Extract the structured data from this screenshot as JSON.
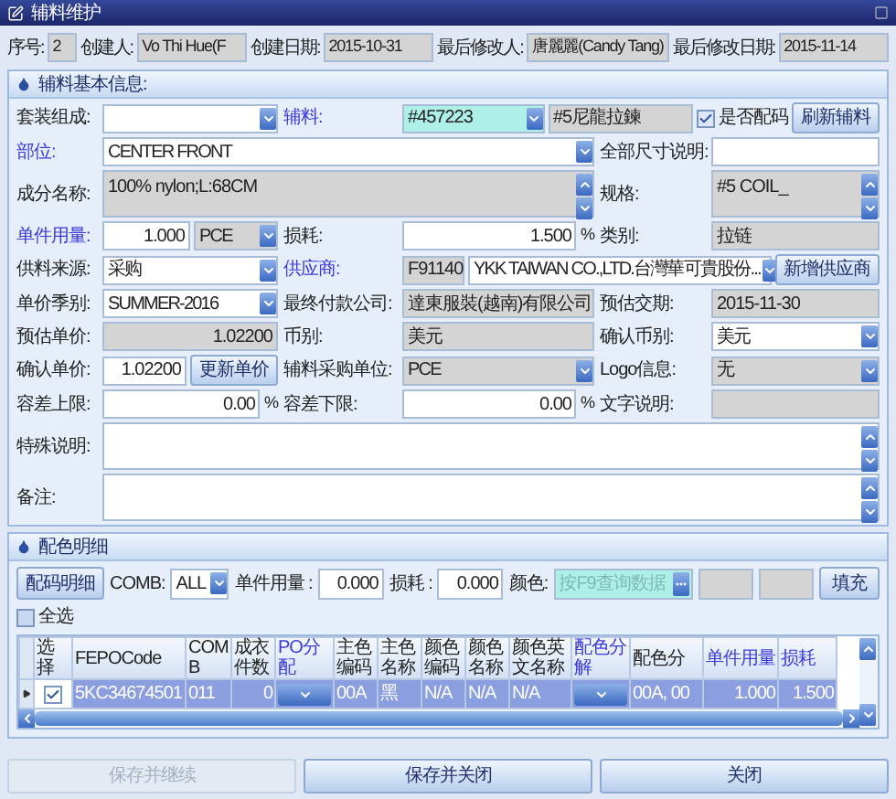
{
  "window": {
    "title": "辅料维护"
  },
  "header": [
    {
      "label": "序号:",
      "value": "2"
    },
    {
      "label": "创建人:",
      "value": "Vo Thi Hue(F"
    },
    {
      "label": "创建日期:",
      "value": "2015-10-31"
    },
    {
      "label": "最后修改人:",
      "value": "唐麗麗(Candy Tang)"
    },
    {
      "label": "最后修改日期:",
      "value": "2015-11-14"
    }
  ],
  "basic_info": {
    "title": "辅料基本信息:",
    "rows": [
      [
        {
          "label": "套装组成:",
          "required": false,
          "controls": [
            {
              "kind": "select",
              "readonly": false
            }
          ]
        },
        {
          "label": "辅料:",
          "required": true,
          "controls": [
            {
              "kind": "lookup",
              "value": "#457223",
              "readonly": false
            },
            {
              "kind": "text",
              "value": "#5尼龍拉鍊",
              "readonly": true
            },
            {
              "kind": "check",
              "label": "是否配码",
              "checked": true
            },
            {
              "kind": "button",
              "label": "刷新辅料"
            }
          ]
        }
      ],
      [
        {
          "label": "部位:",
          "required": true,
          "controls": [
            {
              "kind": "select",
              "value": "CENTER FRONT",
              "readonly": false
            }
          ]
        },
        {
          "label": "全部尺寸说明:",
          "required": false,
          "controls": [
            {
              "kind": "text",
              "readonly": false
            }
          ]
        }
      ],
      [
        {
          "label": "成分名称:",
          "required": false,
          "controls": [
            {
              "kind": "memo",
              "value": "100% nylon;L:68CM",
              "readonly": true
            }
          ]
        },
        {
          "label": "规格:",
          "required": false,
          "controls": [
            {
              "kind": "spin",
              "value": "#5 COIL_",
              "readonly": true
            }
          ]
        }
      ],
      [
        {
          "label": "单件用量:",
          "required": true,
          "controls": [
            {
              "kind": "number",
              "value": "1.000",
              "readonly": false
            },
            {
              "kind": "select",
              "value": "PCE",
              "readonly": true
            }
          ]
        },
        {
          "label": "损耗:",
          "required": false,
          "controls": [
            {
              "kind": "number",
              "value": "1.500",
              "readonly": false
            },
            {
              "kind": "unit",
              "label": "%"
            }
          ]
        },
        {
          "label": "类别:",
          "required": false,
          "controls": [
            {
              "kind": "text",
              "value": "拉链",
              "readonly": true
            }
          ]
        }
      ],
      [
        {
          "label": "供料来源:",
          "required": false,
          "controls": [
            {
              "kind": "select",
              "value": "采购",
              "readonly": false
            }
          ]
        },
        {
          "label": "供应商:",
          "required": true,
          "controls": [
            {
              "kind": "text",
              "value": "F91140",
              "readonly": true
            },
            {
              "kind": "select",
              "value": "YKK TAIWAN CO.,LTD.台灣華可貴股份...",
              "readonly": false
            },
            {
              "kind": "button",
              "label": "新增供应商"
            }
          ]
        }
      ],
      [
        {
          "label": "单价季别:",
          "required": false,
          "controls": [
            {
              "kind": "select",
              "value": "SUMMER-2016",
              "readonly": false
            }
          ]
        },
        {
          "label": "最终付款公司:",
          "required": false,
          "controls": [
            {
              "kind": "text",
              "value": "達東服裝(越南)有限公司",
              "readonly": true
            }
          ]
        },
        {
          "label": "预估交期:",
          "required": false,
          "controls": [
            {
              "kind": "text",
              "value": "2015-11-30",
              "readonly": true
            }
          ]
        }
      ],
      [
        {
          "label": "预估单价:",
          "required": false,
          "controls": [
            {
              "kind": "number",
              "value": "1.02200",
              "readonly": true
            }
          ]
        },
        {
          "label": "币别:",
          "required": false,
          "controls": [
            {
              "kind": "text",
              "value": "美元",
              "readonly": true
            }
          ]
        },
        {
          "label": "确认币别:",
          "required": false,
          "controls": [
            {
              "kind": "select",
              "value": "美元",
              "readonly": false
            }
          ]
        }
      ],
      [
        {
          "label": "确认单价:",
          "required": false,
          "controls": [
            {
              "kind": "number",
              "value": "1.02200",
              "readonly": false
            },
            {
              "kind": "button",
              "label": "更新单价"
            }
          ]
        },
        {
          "label": "辅料采购单位:",
          "required": false,
          "controls": [
            {
              "kind": "select",
              "value": "PCE",
              "readonly": true
            }
          ]
        },
        {
          "label": "Logo信息:",
          "required": false,
          "controls": [
            {
              "kind": "select",
              "value": "无",
              "readonly": true
            }
          ]
        }
      ],
      [
        {
          "label": "容差上限:",
          "required": false,
          "controls": [
            {
              "kind": "number",
              "value": "0.00",
              "readonly": false
            },
            {
              "kind": "unit",
              "label": "%"
            }
          ]
        },
        {
          "label": "容差下限:",
          "required": false,
          "controls": [
            {
              "kind": "number",
              "value": "0.00",
              "readonly": false
            },
            {
              "kind": "unit",
              "label": "%"
            }
          ]
        },
        {
          "label": "文字说明:",
          "required": false,
          "controls": [
            {
              "kind": "text",
              "readonly": true
            }
          ]
        }
      ],
      [
        {
          "label": "特殊说明:",
          "required": false,
          "controls": [
            {
              "kind": "memo",
              "readonly": false
            }
          ]
        }
      ],
      [
        {
          "label": "备注:",
          "required": false,
          "controls": [
            {
              "kind": "memo",
              "readonly": false
            }
          ]
        }
      ]
    ]
  },
  "color_detail": {
    "title": "配色明细",
    "toolbar": {
      "button": "配码明细",
      "comb": {
        "label": "COMB:",
        "value": "ALL"
      },
      "usage": {
        "label": "单件用量 :",
        "value": "0.000"
      },
      "loss": {
        "label": "损耗 :",
        "value": "0.000"
      },
      "color": {
        "label": "颜色:",
        "placeholder": "按F9查询数据"
      },
      "fill_button": "填充"
    },
    "select_all": {
      "label": "全选",
      "checked": false
    },
    "table": {
      "columns": [
        {
          "kind": "indicator"
        },
        {
          "label": "选择",
          "required": false
        },
        {
          "label": "FEPOCode",
          "required": false
        },
        {
          "label": "COMB",
          "required": false
        },
        {
          "label": "成衣件数",
          "required": false
        },
        {
          "label": "PO分配",
          "required": true
        },
        {
          "label": "主色编码",
          "required": false
        },
        {
          "label": "主色名称",
          "required": false
        },
        {
          "label": "颜色编码",
          "required": false
        },
        {
          "label": "颜色名称",
          "required": false
        },
        {
          "label": "颜色英文名称",
          "required": false
        },
        {
          "label": "配色分解",
          "required": true
        },
        {
          "label": "配色分",
          "required": false
        },
        {
          "label": "单件用量",
          "required": true
        },
        {
          "label": "损耗",
          "required": true
        }
      ],
      "rows": [
        {
          "selected": true,
          "cells": [
            {
              "kind": "indicator"
            },
            {
              "kind": "check",
              "checked": true
            },
            {
              "kind": "text",
              "text": "5KC34674501"
            },
            {
              "kind": "text",
              "text": "011"
            },
            {
              "kind": "number",
              "text": "0"
            },
            {
              "kind": "dropdown"
            },
            {
              "kind": "text",
              "text": "00A"
            },
            {
              "kind": "text",
              "text": "黑"
            },
            {
              "kind": "text",
              "text": "N/A"
            },
            {
              "kind": "text",
              "text": "N/A"
            },
            {
              "kind": "text",
              "text": "N/A"
            },
            {
              "kind": "dropdown"
            },
            {
              "kind": "text",
              "text": "00A, 00"
            },
            {
              "kind": "number",
              "text": "1.000"
            },
            {
              "kind": "number",
              "text": "1.500"
            }
          ]
        }
      ]
    }
  },
  "buttons": [
    {
      "label": "保存并继续",
      "disabled": true
    },
    {
      "label": "保存并关闭",
      "disabled": false
    },
    {
      "label": "关闭",
      "disabled": false
    }
  ]
}
